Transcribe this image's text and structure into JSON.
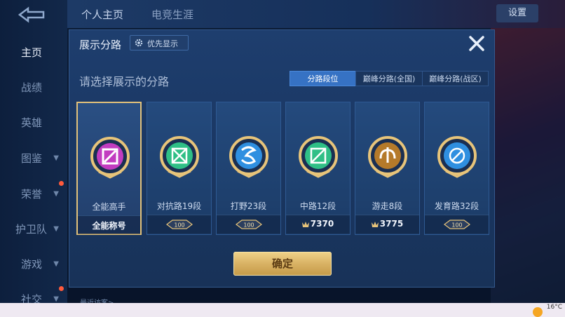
{
  "sidebar": {
    "logo_icon": "back-arrow-icon",
    "items": [
      {
        "label": "主页",
        "active": true
      },
      {
        "label": "战绩"
      },
      {
        "label": "英雄"
      },
      {
        "label": "图鉴"
      },
      {
        "label": "荣誉"
      },
      {
        "label": "护卫队"
      },
      {
        "label": "游戏"
      },
      {
        "label": "社交"
      }
    ]
  },
  "topbar": {
    "tabs": [
      "个人主页",
      "电竞生涯"
    ],
    "settings_label": "设置"
  },
  "dialog": {
    "title": "展示分路",
    "priority_button": "优先显示",
    "subtitle": "请选择展示的分路",
    "segments": [
      "分路段位",
      "巅峰分路(全国)",
      "巅峰分路(战区)"
    ],
    "active_segment": 0,
    "cards": [
      {
        "name": "全能高手",
        "rank": "全能称号",
        "rank_type": "text",
        "emblem": "all-round-emblem",
        "color": "#c23cc0",
        "selected": true
      },
      {
        "name": "对抗路19段",
        "rank": "100",
        "rank_type": "badge",
        "emblem": "clash-lane-emblem",
        "color": "#2fbf86"
      },
      {
        "name": "打野23段",
        "rank": "100",
        "rank_type": "badge",
        "emblem": "jungle-emblem",
        "color": "#2f8fe0"
      },
      {
        "name": "中路12段",
        "rank": "7370",
        "rank_type": "points",
        "emblem": "mid-lane-emblem",
        "color": "#2fbf86"
      },
      {
        "name": "游走8段",
        "rank": "3775",
        "rank_type": "points",
        "emblem": "roam-emblem",
        "color": "#b57a2a"
      },
      {
        "name": "发育路32段",
        "rank": "100",
        "rank_type": "badge",
        "emblem": "farm-lane-emblem",
        "color": "#2f8fe0"
      }
    ],
    "confirm_label": "确定"
  },
  "footer": {
    "recent_visitors": "最近访客>",
    "weather": "16°C"
  }
}
